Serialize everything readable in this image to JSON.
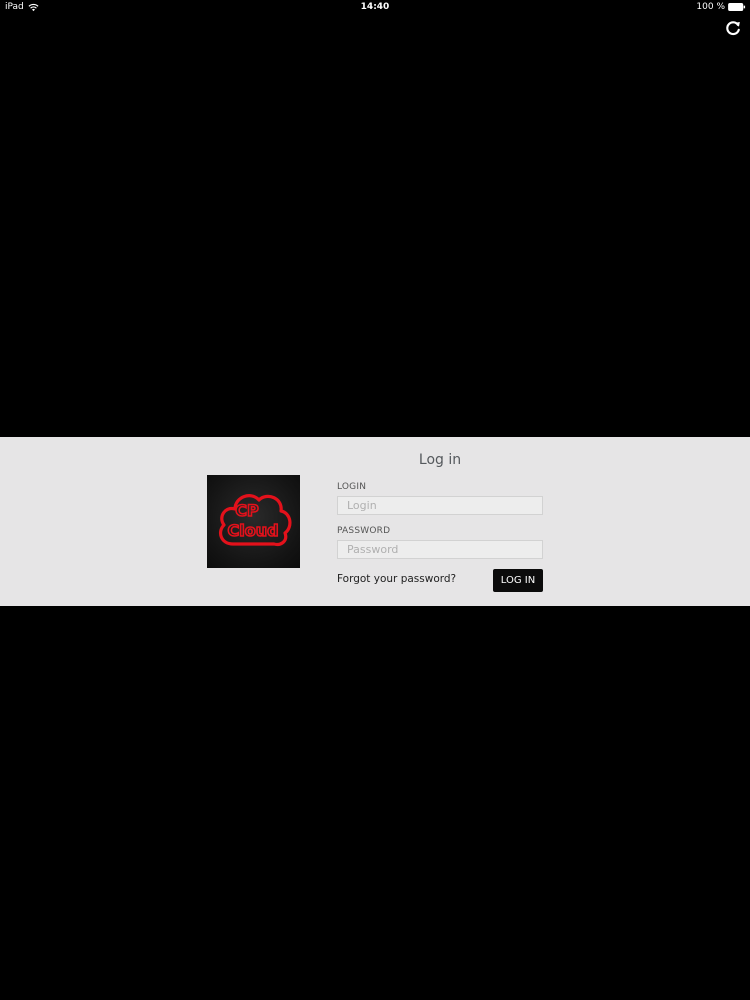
{
  "status_bar": {
    "device": "iPad",
    "time": "14:40",
    "battery": "100 %"
  },
  "icons": {
    "wifi": "wifi-icon",
    "battery": "battery-icon",
    "reload": "reload-icon"
  },
  "logo": {
    "line1": "CP",
    "line2": "Cloud",
    "color": "#e3111b"
  },
  "login_form": {
    "title": "Log in",
    "login_label": "LOGIN",
    "login_placeholder": "Login",
    "login_value": "",
    "password_label": "PASSWORD",
    "password_placeholder": "Password",
    "password_value": "",
    "forgot_link": "Forgot your password?",
    "submit_label": "LOG IN"
  },
  "colors": {
    "background": "#000000",
    "band": "#e6e5e6",
    "button": "#0b0b0b"
  }
}
